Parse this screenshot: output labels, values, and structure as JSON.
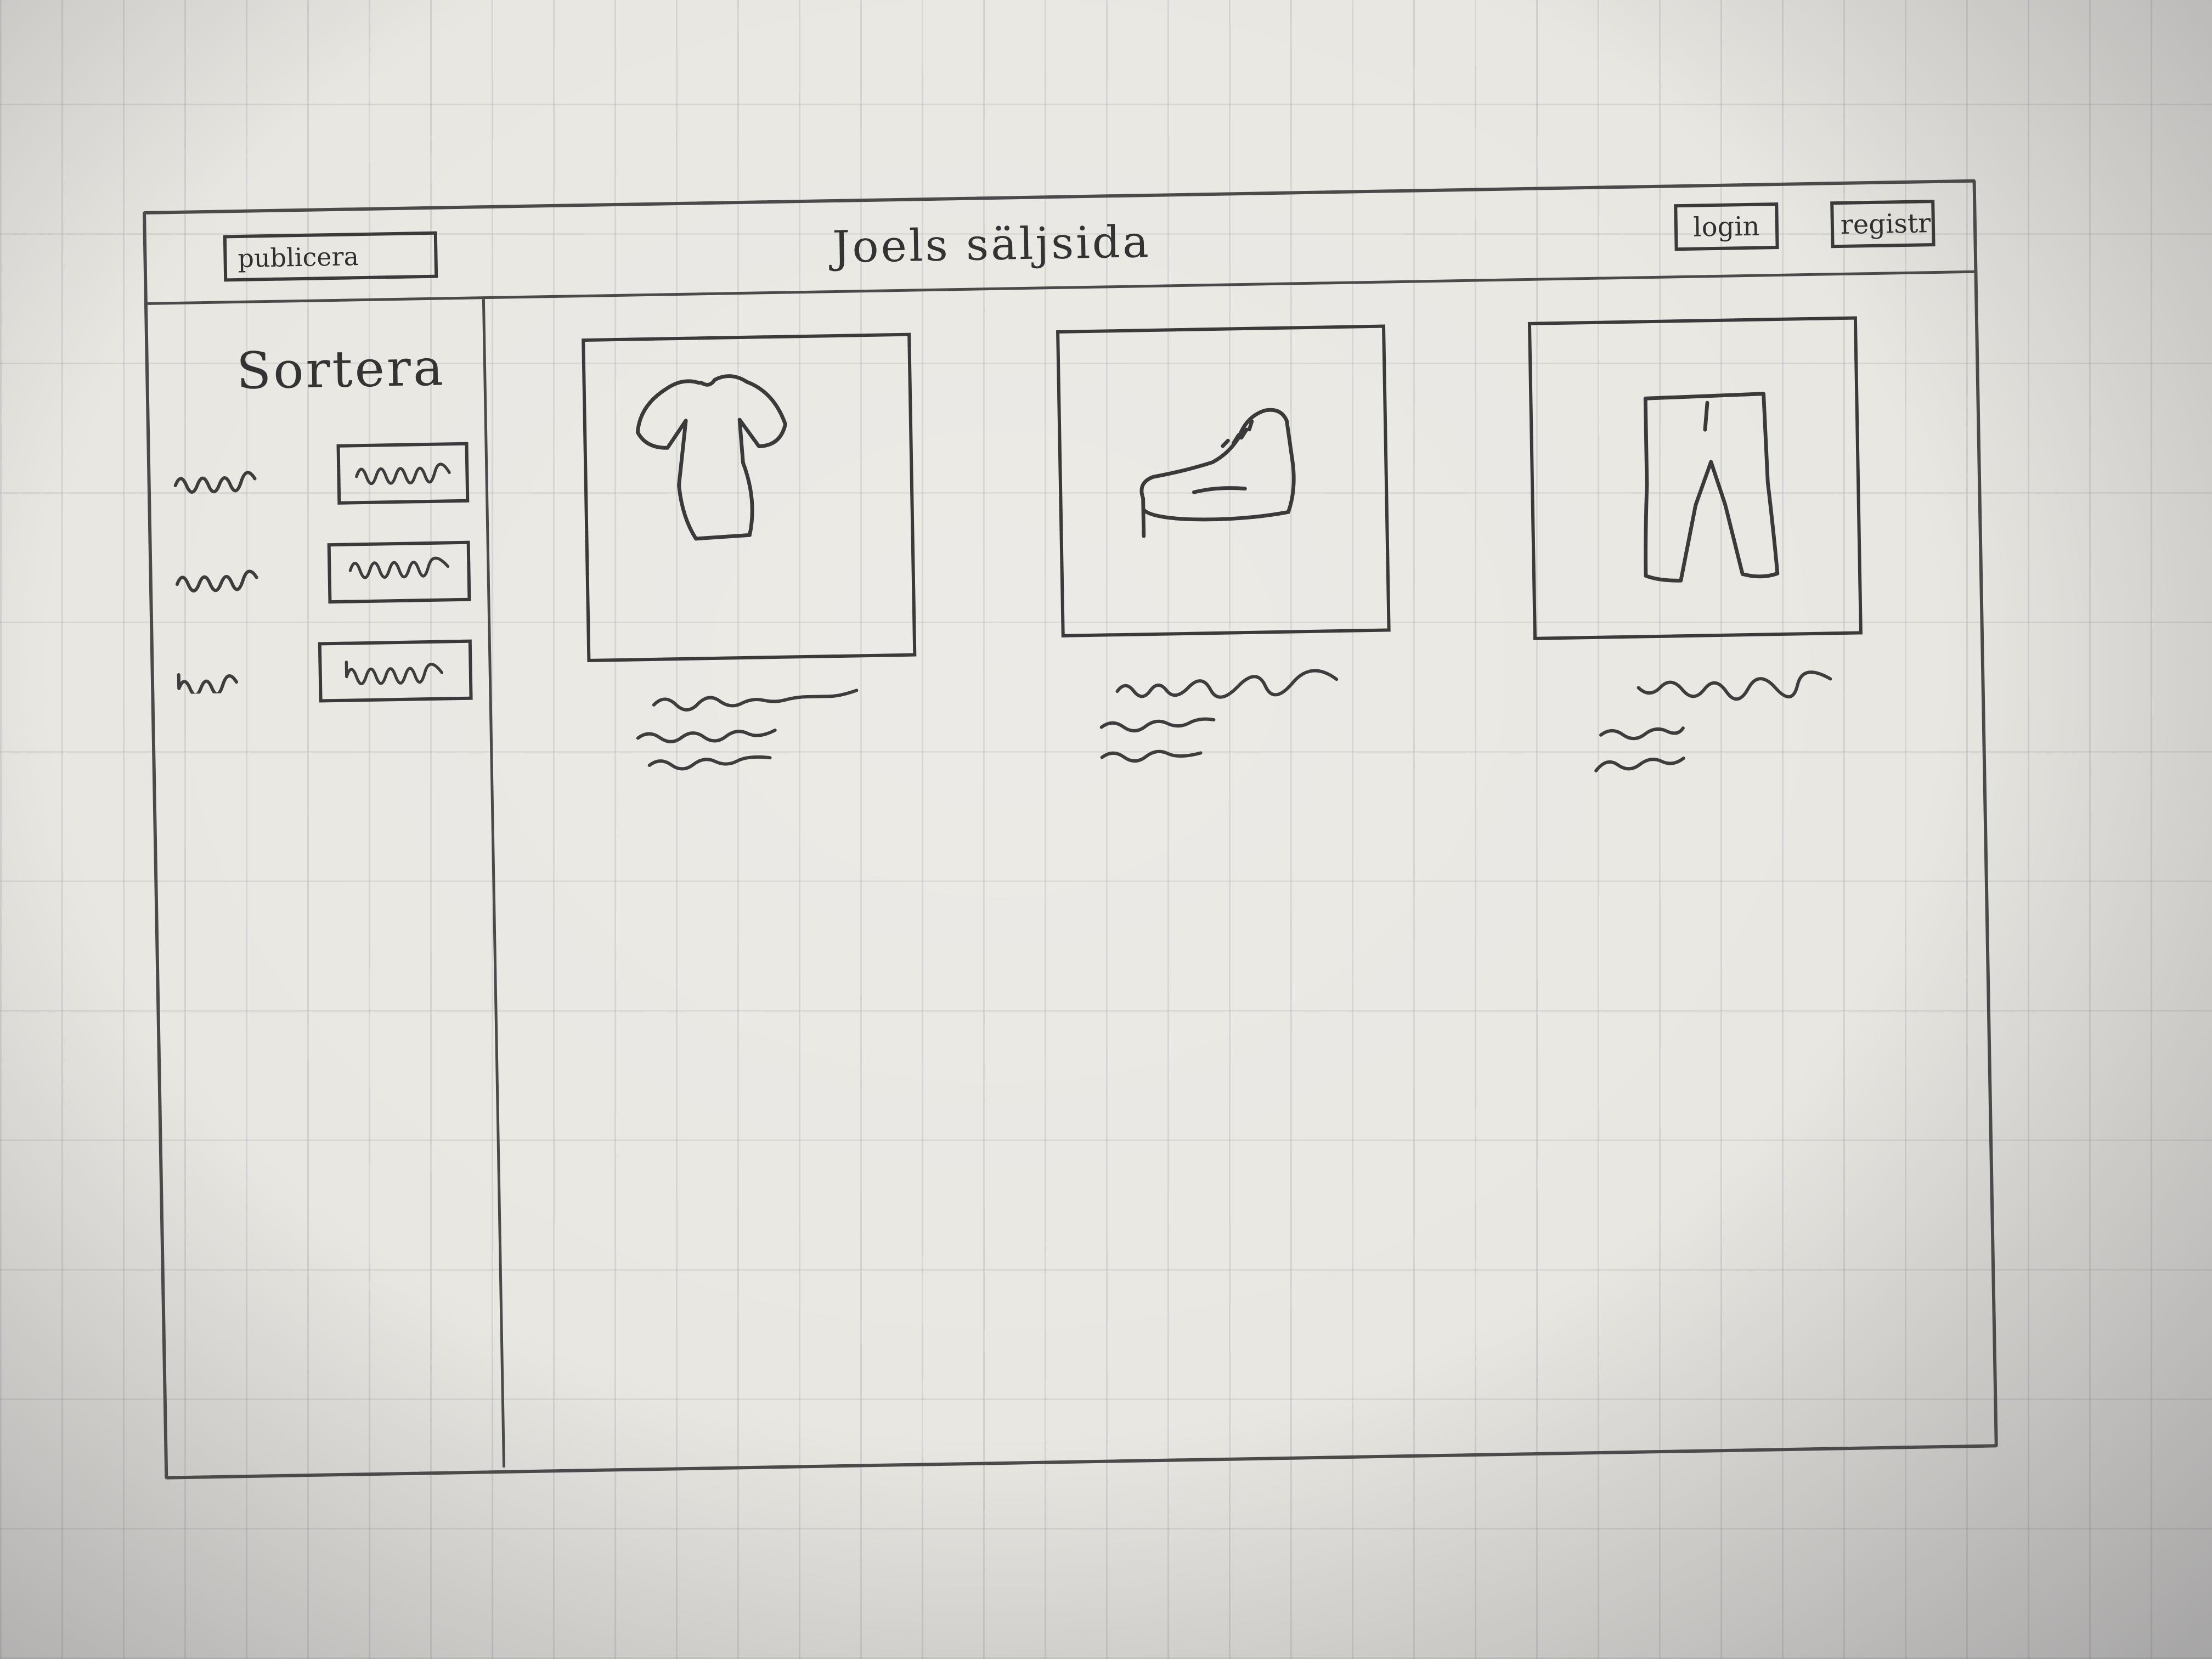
{
  "header": {
    "publish_label": "publicera",
    "site_title": "Joels säljsida",
    "login_label": "login",
    "register_label": "registr"
  },
  "sidebar": {
    "title": "Sortera",
    "filters": [
      {
        "label_icon": "squiggle-placeholder",
        "box_icon": "squiggle-placeholder"
      },
      {
        "label_icon": "squiggle-placeholder",
        "box_icon": "squiggle-placeholder"
      },
      {
        "label_icon": "squiggle-placeholder",
        "box_icon": "squiggle-placeholder"
      }
    ]
  },
  "products": [
    {
      "image_icon": "tshirt-icon"
    },
    {
      "image_icon": "shoe-icon"
    },
    {
      "image_icon": "pants-icon"
    }
  ]
}
